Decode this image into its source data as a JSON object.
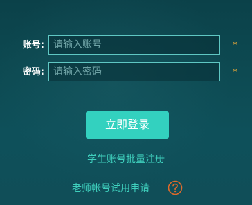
{
  "form": {
    "account": {
      "label": "账号:",
      "placeholder": "请输入账号",
      "value": "",
      "required_mark": "*"
    },
    "password": {
      "label": "密码:",
      "placeholder": "请输入密码",
      "value": "",
      "required_mark": "*"
    },
    "login_button": "立即登录"
  },
  "links": {
    "student_batch_register": "学生账号批量注册",
    "teacher_trial_apply": "老师帐号试用申请"
  },
  "icons": {
    "help": "help-circle-icon"
  },
  "colors": {
    "background_top": "#0b4149",
    "background_bottom": "#104e58",
    "accent": "#33d1bf",
    "link": "#3fd0bd",
    "input_border": "#5fc7c3",
    "required": "#e0a43a",
    "help_icon": "#e06a2a"
  }
}
